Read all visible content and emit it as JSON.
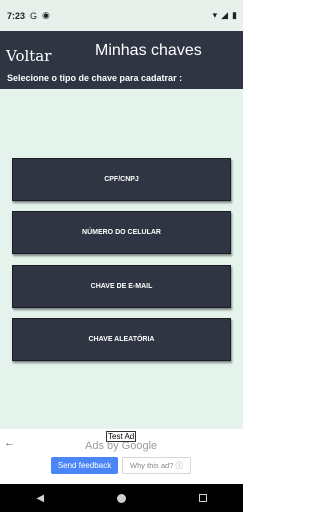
{
  "status_bar": {
    "time": "7:23",
    "icons": [
      "g-icon",
      "media-icon",
      "wifi-icon",
      "signal-icon",
      "battery-icon"
    ]
  },
  "header": {
    "back_label": "Voltar",
    "title": "Minhas chaves",
    "subtitle": "Selecione o tipo de chave para cadatrar :"
  },
  "key_types": [
    {
      "label": "CPF/CNPJ"
    },
    {
      "label": "NÚMERO DO CELULAR"
    },
    {
      "label": "CHAVE DE E-MAIL"
    },
    {
      "label": "CHAVE ALEATÓRIA"
    }
  ],
  "ad": {
    "test_label": "Test Ad",
    "ads_by": "Ads by Google",
    "send_feedback": "Send feedback",
    "why_this_ad": "Why this ad? ⓘ"
  },
  "colors": {
    "header_bg": "#2f3543",
    "content_bg": "#e4f3ec",
    "button_bg": "#2f3543",
    "feedback_btn": "#4a86f7"
  }
}
